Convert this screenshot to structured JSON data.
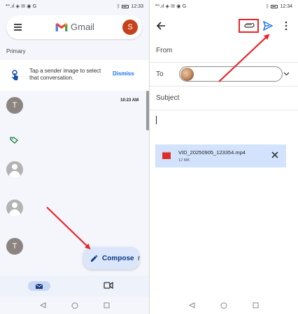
{
  "left": {
    "status": {
      "icons": "⁴ᴳ.ıl ◈ ✉ ◉ G",
      "time": "12:33"
    },
    "header": {
      "app_name": "Gmail",
      "avatar_initial": "S"
    },
    "section_label": "Primary",
    "tip": {
      "text": "Tap a sender image to select that conversation.",
      "dismiss_label": "Dismiss"
    },
    "emails": [
      {
        "avatar_initial": "T",
        "time": "10:23 AM"
      },
      {
        "avatar_initial": "T"
      }
    ],
    "compose": {
      "label": "Compose",
      "peek": "r"
    },
    "colors": {
      "accent": "#1a73e8",
      "compose_bg": "#dbe6fb",
      "annotation": "#e8242a"
    }
  },
  "right": {
    "status": {
      "icons": "⁴ᴳ.ıl ◈ ✉ ◉ G",
      "time": "12:34"
    },
    "fields": {
      "from_label": "From",
      "to_label": "To",
      "subject_label": "Subject"
    },
    "attachment": {
      "name": "VID_20250905_123354.mp4",
      "size": "12 MB"
    }
  }
}
